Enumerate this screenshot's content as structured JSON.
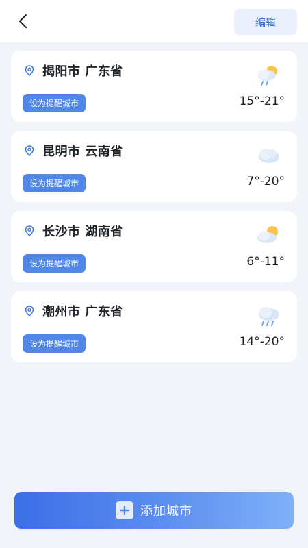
{
  "header": {
    "back_icon": "chevron-left-icon",
    "edit_label": "编辑"
  },
  "cities": [
    {
      "name": "揭阳市 广东省",
      "remind_label": "设为提醒城市",
      "temp": "15°-21°",
      "weather_icon": "partly-cloudy-rain-icon"
    },
    {
      "name": "昆明市 云南省",
      "remind_label": "设为提醒城市",
      "temp": "7°-20°",
      "weather_icon": "cloudy-icon"
    },
    {
      "name": "长沙市 湖南省",
      "remind_label": "设为提醒城市",
      "temp": "6°-11°",
      "weather_icon": "partly-cloudy-icon"
    },
    {
      "name": "潮州市 广东省",
      "remind_label": "设为提醒城市",
      "temp": "14°-20°",
      "weather_icon": "rain-icon"
    }
  ],
  "footer": {
    "add_label": "添加城市",
    "add_icon": "plus-icon"
  },
  "colors": {
    "accent": "#4f86e8",
    "background": "#f1f4f9",
    "edit_text": "#3a6fd0"
  }
}
